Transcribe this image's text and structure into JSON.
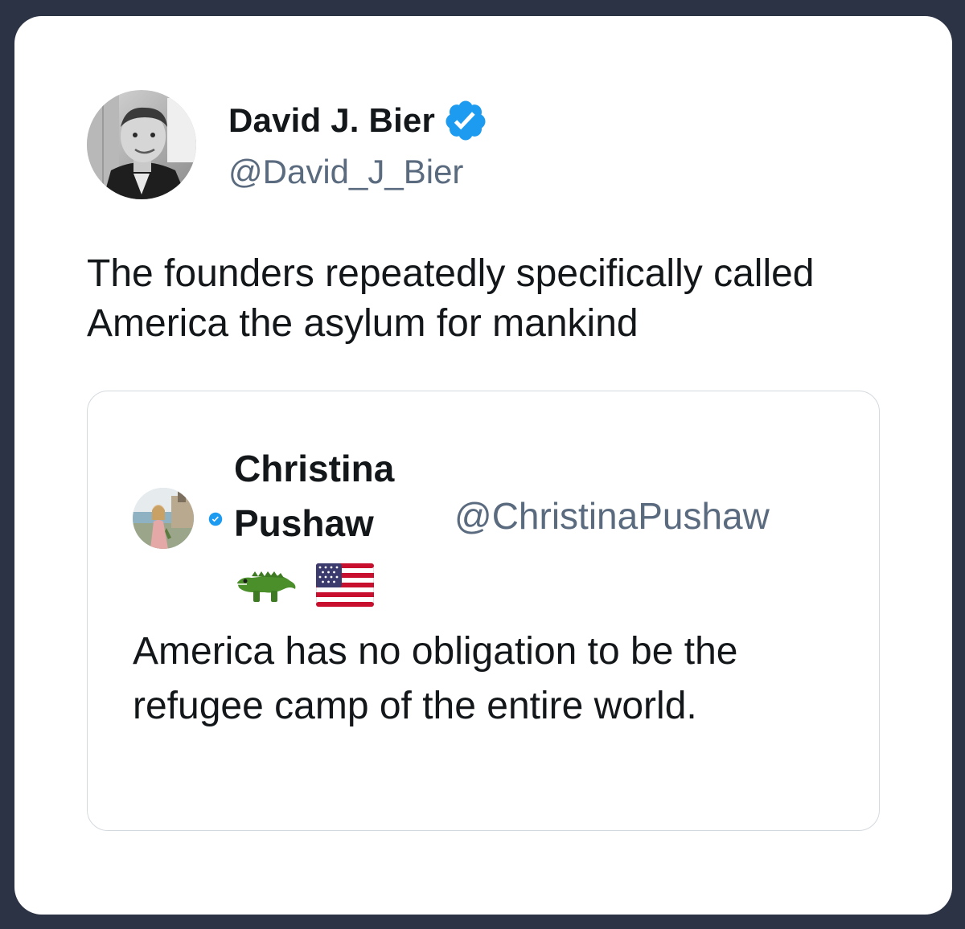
{
  "tweet": {
    "author": {
      "display_name": "David J. Bier",
      "handle": "@David_J_Bier",
      "verified": true,
      "avatar_icon": "profile-photo-man-in-suit"
    },
    "text": "The founders repeatedly specifically called America the asylum for mankind"
  },
  "quoted_tweet": {
    "author": {
      "display_name": "Christina Pushaw",
      "emoji": [
        "crocodile",
        "us-flag"
      ],
      "handle": "@ChristinaPushaw",
      "verified": true,
      "avatar_icon": "profile-photo-woman-outdoors"
    },
    "text": "America has no obligation to be the refugee camp of the entire world."
  },
  "colors": {
    "background": "#2b3345",
    "card": "#ffffff",
    "verified_blue": "#1d9bf0",
    "handle_gray": "#5b6b7f",
    "text": "#14171a",
    "quote_border": "#d4d9de"
  }
}
